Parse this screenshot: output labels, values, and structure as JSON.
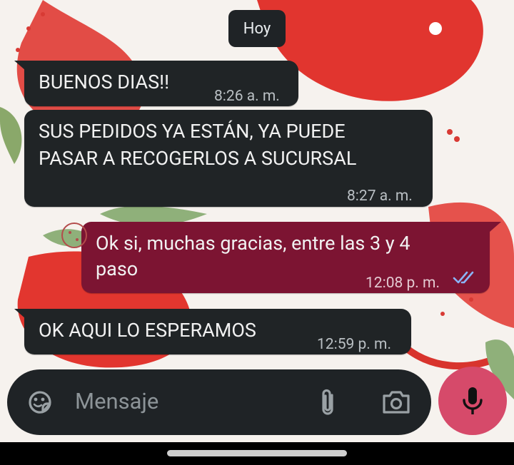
{
  "chat": {
    "date_chip": "Hoy",
    "messages": [
      {
        "direction": "incoming",
        "text": "BUENOS DIAS!!",
        "time": "8:26 a. m."
      },
      {
        "direction": "incoming",
        "text_lines": [
          "SUS PEDIDOS YA ESTÁN, YA PUEDE",
          "PASAR A RECOGERLOS A SUCURSAL"
        ],
        "time": "8:27 a. m."
      },
      {
        "direction": "outgoing",
        "text_lines": [
          "Ok si, muchas gracias, entre las 3 y 4",
          "paso"
        ],
        "time": "12:08 p. m.",
        "status": "read",
        "status_icon": "double-check-icon"
      },
      {
        "direction": "incoming",
        "text": "OK AQUI LO ESPERAMOS",
        "time": "12:59 p. m."
      }
    ]
  },
  "composer": {
    "placeholder": "Mensaje",
    "icons": [
      "sticker-icon",
      "paperclip-icon",
      "camera-icon",
      "microphone-icon"
    ]
  },
  "colors": {
    "incoming_bubble": "#202426",
    "outgoing_bubble": "#7c1432",
    "mic_button": "#d64a6a",
    "read_ticks": "#8ab4f8"
  }
}
